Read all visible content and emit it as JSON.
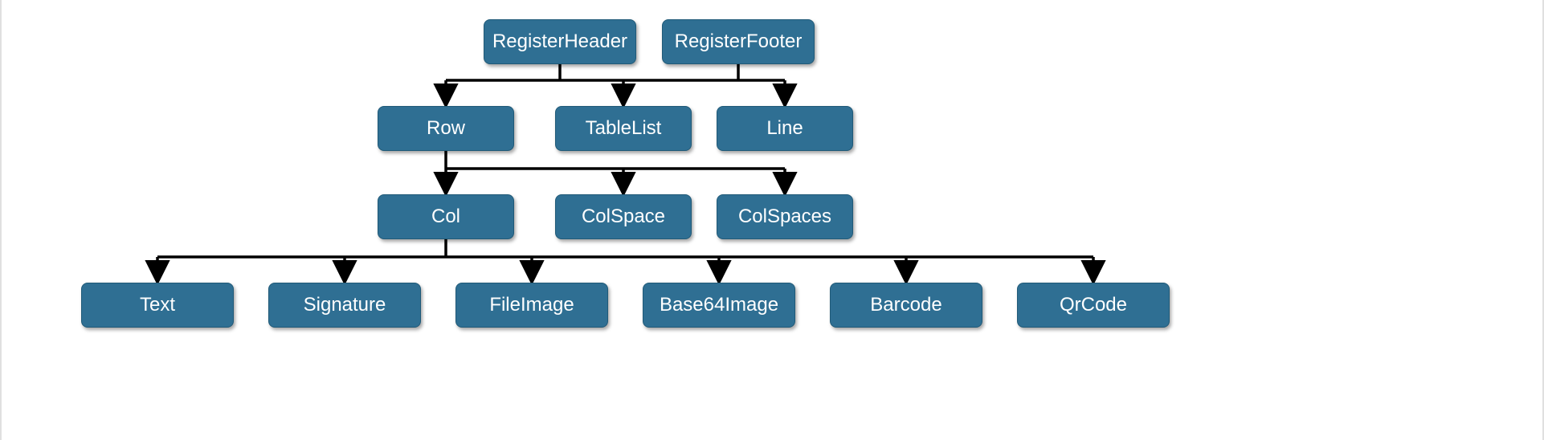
{
  "diagram": {
    "nodes": {
      "registerHeader": "RegisterHeader",
      "registerFooter": "RegisterFooter",
      "row": "Row",
      "tableList": "TableList",
      "line": "Line",
      "col": "Col",
      "colSpace": "ColSpace",
      "colSpaces": "ColSpaces",
      "text": "Text",
      "signature": "Signature",
      "fileImage": "FileImage",
      "base64Image": "Base64Image",
      "barcode": "Barcode",
      "qrCode": "QrCode"
    },
    "colors": {
      "nodeFill": "#2f6f93",
      "nodeText": "#ffffff",
      "edge": "#000000",
      "background": "#ffffff"
    },
    "hierarchy": {
      "roots": [
        "RegisterHeader",
        "RegisterFooter"
      ],
      "children": {
        "RegisterHeader+RegisterFooter": [
          "Row",
          "TableList",
          "Line"
        ],
        "Row": [
          "Col",
          "ColSpace",
          "ColSpaces"
        ],
        "Col": [
          "Text",
          "Signature",
          "FileImage",
          "Base64Image",
          "Barcode",
          "QrCode"
        ]
      }
    }
  }
}
